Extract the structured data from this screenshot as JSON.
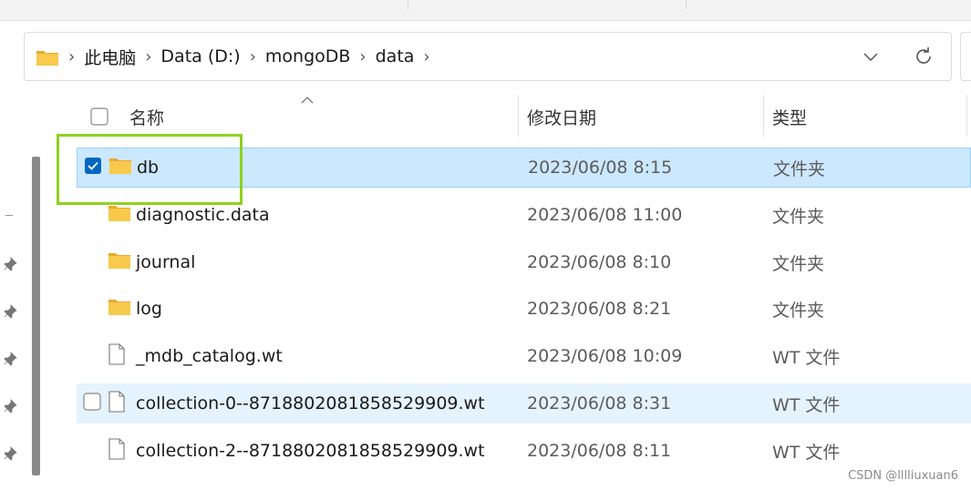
{
  "breadcrumb": [
    "此电脑",
    "Data (D:)",
    "mongoDB",
    "data"
  ],
  "columns": {
    "name": "名称",
    "date": "修改日期",
    "type": "类型"
  },
  "rows": [
    {
      "name": "db",
      "date": "2023/06/08 8:15",
      "type": "文件夹",
      "kind": "folder",
      "state": "selected"
    },
    {
      "name": "diagnostic.data",
      "date": "2023/06/08 11:00",
      "type": "文件夹",
      "kind": "folder",
      "state": ""
    },
    {
      "name": "journal",
      "date": "2023/06/08 8:10",
      "type": "文件夹",
      "kind": "folder",
      "state": ""
    },
    {
      "name": "log",
      "date": "2023/06/08 8:21",
      "type": "文件夹",
      "kind": "folder",
      "state": ""
    },
    {
      "name": "_mdb_catalog.wt",
      "date": "2023/06/08 10:09",
      "type": "WT 文件",
      "kind": "file",
      "state": ""
    },
    {
      "name": "collection-0--8718802081858529909.wt",
      "date": "2023/06/08 8:31",
      "type": "WT 文件",
      "kind": "file",
      "state": "hover"
    },
    {
      "name": "collection-2--8718802081858529909.wt",
      "date": "2023/06/08 8:11",
      "type": "WT 文件",
      "kind": "file",
      "state": ""
    }
  ],
  "watermark": "CSDN @lllliuxuan6",
  "colors": {
    "selected_bg": "#cce8ff",
    "hover_bg": "#e5f3ff",
    "highlight": "#8ed21f",
    "folder": "#f4c443",
    "check": "#0067c0"
  },
  "icons": {
    "folder": "folder-icon",
    "file": "file-icon",
    "refresh": "refresh-icon",
    "dropdown": "chevron-down-icon",
    "pin": "pin-icon"
  }
}
